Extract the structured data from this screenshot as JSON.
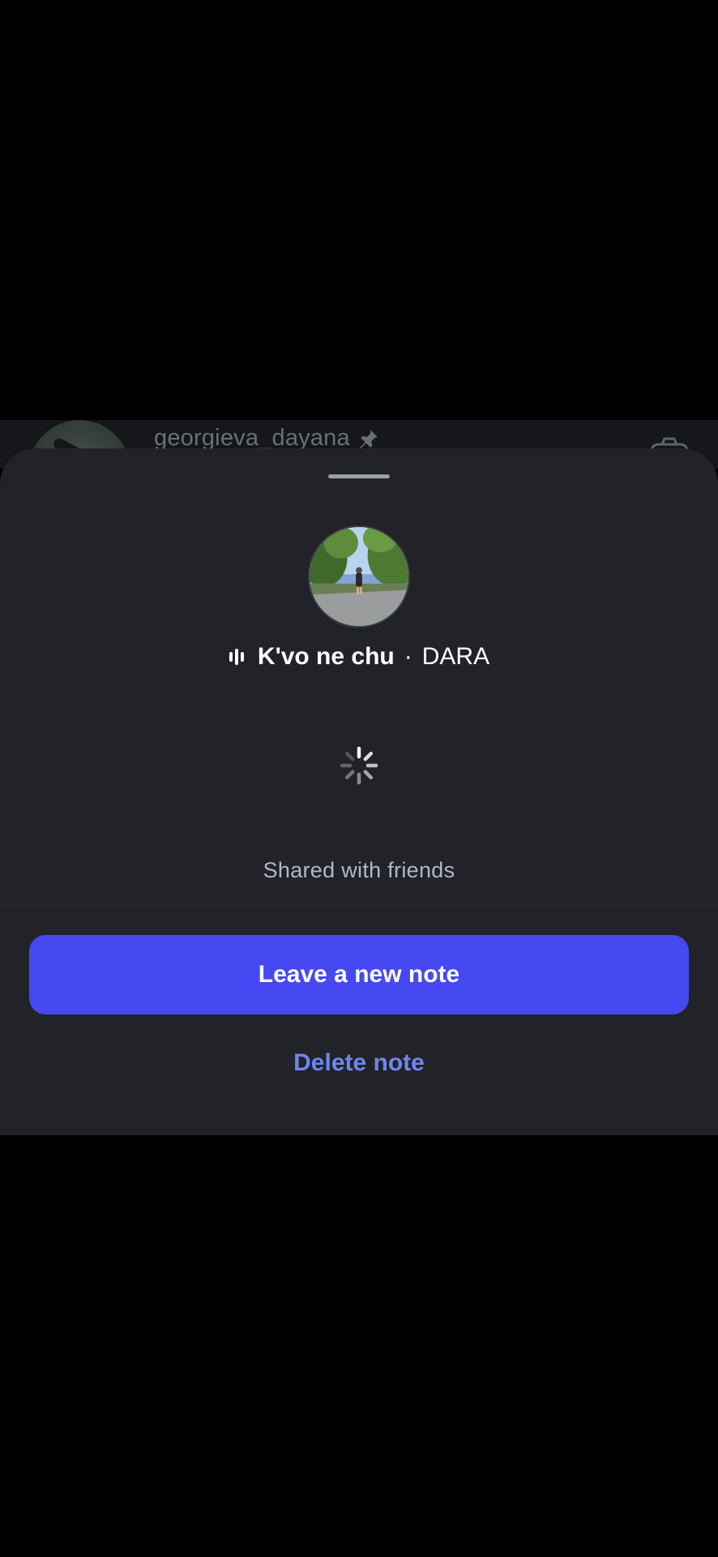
{
  "background_row": {
    "username": "georgieva_dayana",
    "pin_icon": "pin-icon",
    "camera_icon": "camera-icon"
  },
  "note_sheet": {
    "song": {
      "icon": "audio-waveform-icon",
      "title": "K'vo ne chu",
      "separator": "·",
      "artist": "DARA"
    },
    "status_icon": "loading-spinner-icon",
    "audience": "Shared with friends",
    "primary_action": "Leave a new note",
    "secondary_action": "Delete note"
  },
  "colors": {
    "sheet_bg": "#212328",
    "primary_button": "#4648f2",
    "secondary_link": "#6f86f0",
    "overlay": "#000000"
  }
}
